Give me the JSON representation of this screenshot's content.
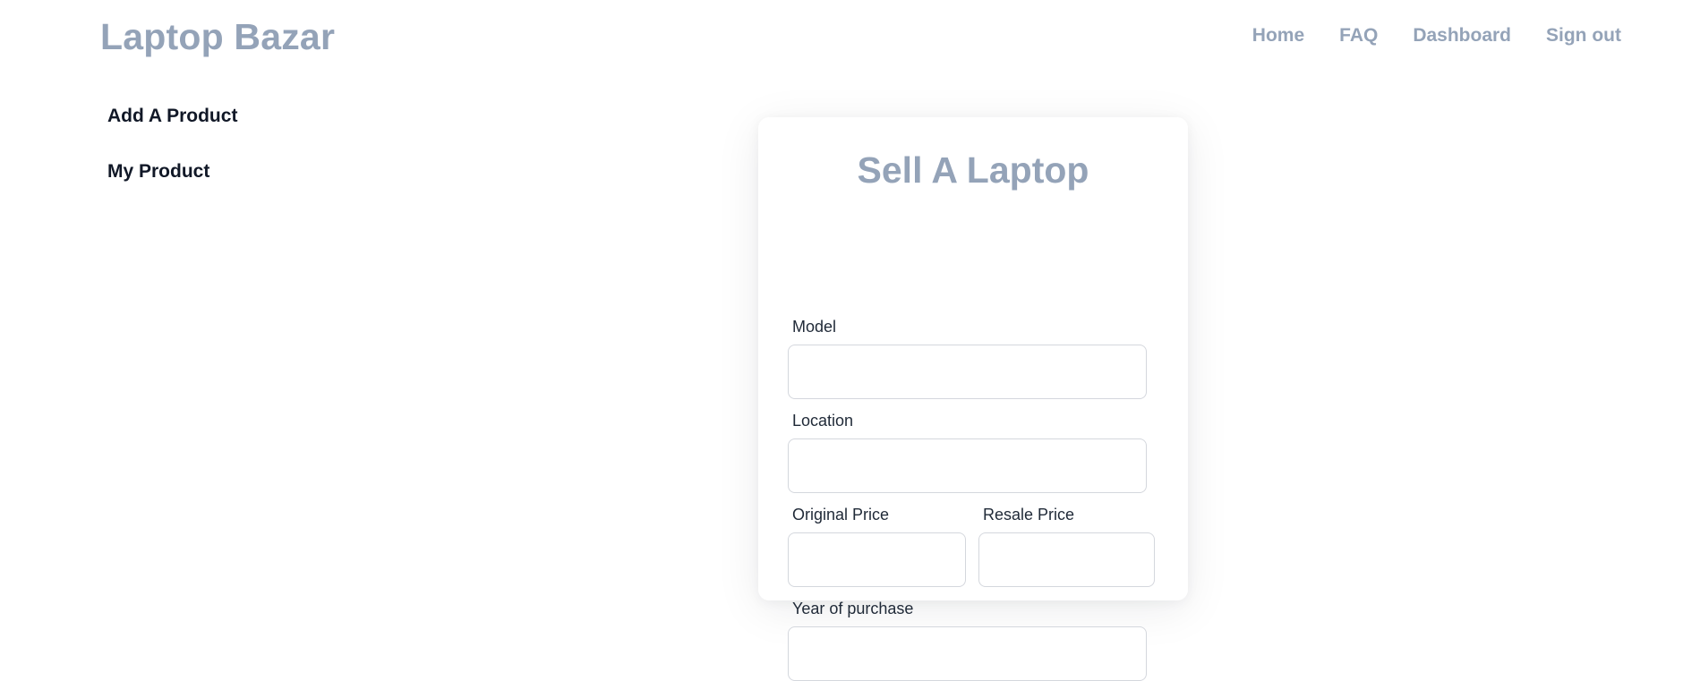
{
  "header": {
    "brand": "Laptop Bazar",
    "nav": [
      {
        "label": "Home"
      },
      {
        "label": "FAQ"
      },
      {
        "label": "Dashboard"
      },
      {
        "label": "Sign out"
      }
    ]
  },
  "sidebar": {
    "items": [
      {
        "label": "Add A Product"
      },
      {
        "label": "My Product"
      }
    ]
  },
  "form": {
    "title": "Sell A Laptop",
    "model": {
      "label": "Model",
      "value": ""
    },
    "location": {
      "label": "Location",
      "value": ""
    },
    "original_price": {
      "label": "Original Price",
      "value": ""
    },
    "resale_price": {
      "label": "Resale Price",
      "value": ""
    },
    "year_of_purchase": {
      "label": "Year of purchase",
      "value": ""
    }
  },
  "colors": {
    "brand": "#94a3b8",
    "text": "#111827",
    "input_border": "#d4d7dd"
  }
}
